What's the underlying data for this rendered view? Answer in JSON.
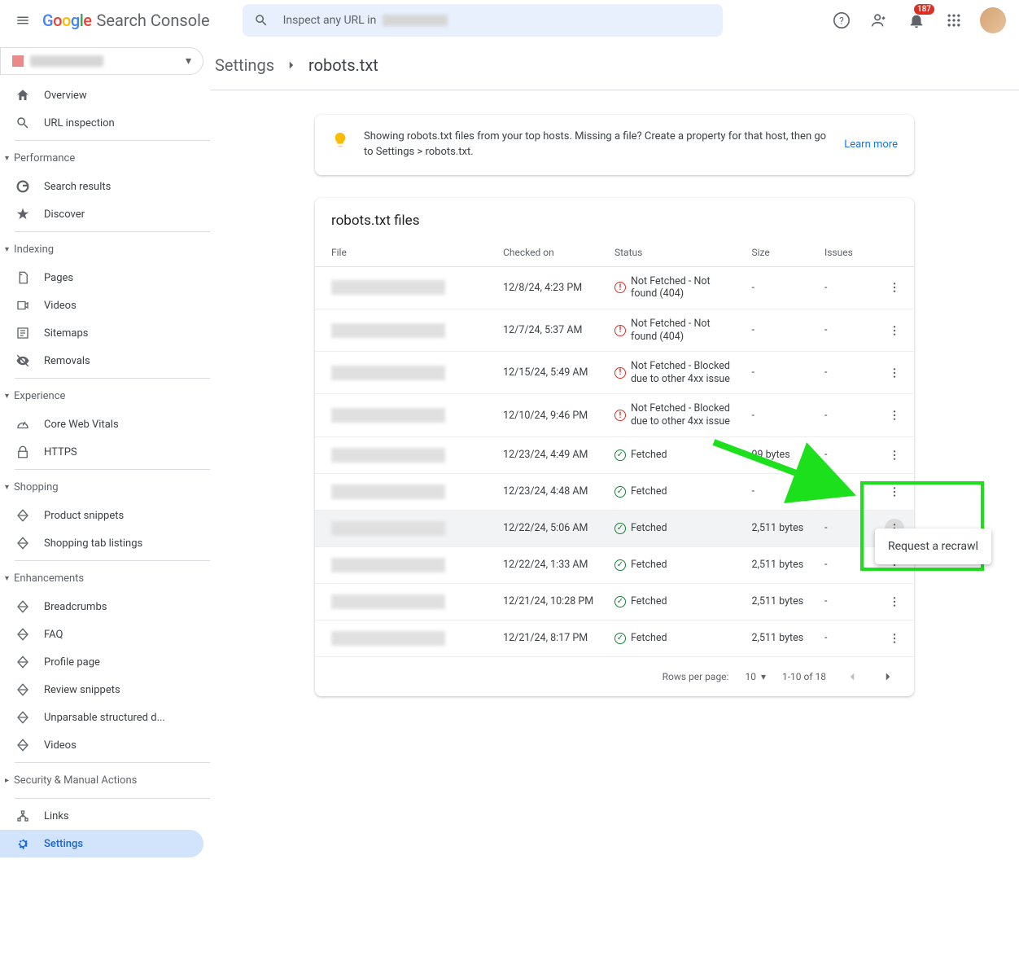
{
  "header": {
    "logo_google": "Google",
    "logo_product": "Search Console",
    "search_placeholder": "Inspect any URL in",
    "notif_count": "187"
  },
  "breadcrumb": {
    "settings": "Settings",
    "current": "robots.txt"
  },
  "info_card": {
    "text": "Showing robots.txt files from your top hosts. Missing a file? Create a property for that host, then go to Settings > robots.txt.",
    "learn_more": "Learn more"
  },
  "table": {
    "title": "robots.txt files",
    "cols": {
      "file": "File",
      "checked": "Checked on",
      "status": "Status",
      "size": "Size",
      "issues": "Issues"
    },
    "rows": [
      {
        "checked": "12/8/24, 4:23 PM",
        "status": "Not Fetched - Not found (404)",
        "ok": false,
        "size": "-",
        "issues": "-"
      },
      {
        "checked": "12/7/24, 5:37 AM",
        "status": "Not Fetched - Not found (404)",
        "ok": false,
        "size": "-",
        "issues": "-"
      },
      {
        "checked": "12/15/24, 5:49 AM",
        "status": "Not Fetched - Blocked due to other 4xx issue",
        "ok": false,
        "size": "-",
        "issues": "-"
      },
      {
        "checked": "12/10/24, 9:46 PM",
        "status": "Not Fetched - Blocked due to other 4xx issue",
        "ok": false,
        "size": "-",
        "issues": "-"
      },
      {
        "checked": "12/23/24, 4:49 AM",
        "status": "Fetched",
        "ok": true,
        "size": "99 bytes",
        "issues": "-"
      },
      {
        "checked": "12/23/24, 4:48 AM",
        "status": "Fetched",
        "ok": true,
        "size": "-",
        "issues": "-"
      },
      {
        "checked": "12/22/24, 5:06 AM",
        "status": "Fetched",
        "ok": true,
        "size": "2,511 bytes",
        "issues": "-",
        "active": true
      },
      {
        "checked": "12/22/24, 1:33 AM",
        "status": "Fetched",
        "ok": true,
        "size": "2,511 bytes",
        "issues": "-"
      },
      {
        "checked": "12/21/24, 10:28 PM",
        "status": "Fetched",
        "ok": true,
        "size": "2,511 bytes",
        "issues": "-"
      },
      {
        "checked": "12/21/24, 8:17 PM",
        "status": "Fetched",
        "ok": true,
        "size": "2,511 bytes",
        "issues": "-"
      }
    ],
    "pagination": {
      "rows_per_page_label": "Rows per page:",
      "per_page": "10",
      "range": "1-10 of 18"
    },
    "popup": "Request a recrawl"
  },
  "sidebar": {
    "groups": [
      {
        "items": [
          {
            "icon": "home",
            "label": "Overview"
          },
          {
            "icon": "search",
            "label": "URL inspection"
          }
        ]
      },
      {
        "header": "Performance",
        "items": [
          {
            "icon": "g",
            "label": "Search results"
          },
          {
            "icon": "star",
            "label": "Discover"
          }
        ]
      },
      {
        "header": "Indexing",
        "items": [
          {
            "icon": "pages",
            "label": "Pages"
          },
          {
            "icon": "video",
            "label": "Videos"
          },
          {
            "icon": "sitemap",
            "label": "Sitemaps"
          },
          {
            "icon": "remove",
            "label": "Removals"
          }
        ]
      },
      {
        "header": "Experience",
        "items": [
          {
            "icon": "speed",
            "label": "Core Web Vitals"
          },
          {
            "icon": "lock",
            "label": "HTTPS"
          }
        ]
      },
      {
        "header": "Shopping",
        "items": [
          {
            "icon": "diamond",
            "label": "Product snippets"
          },
          {
            "icon": "diamond",
            "label": "Shopping tab listings"
          }
        ]
      },
      {
        "header": "Enhancements",
        "items": [
          {
            "icon": "diamond",
            "label": "Breadcrumbs"
          },
          {
            "icon": "diamond",
            "label": "FAQ"
          },
          {
            "icon": "diamond",
            "label": "Profile page"
          },
          {
            "icon": "diamond",
            "label": "Review snippets"
          },
          {
            "icon": "diamond",
            "label": "Unparsable structured d..."
          },
          {
            "icon": "diamond",
            "label": "Videos"
          }
        ]
      },
      {
        "header": "Security & Manual Actions",
        "collapsed": true,
        "items": []
      },
      {
        "items": [
          {
            "icon": "links",
            "label": "Links"
          },
          {
            "icon": "gear",
            "label": "Settings",
            "selected": true
          }
        ]
      }
    ]
  }
}
